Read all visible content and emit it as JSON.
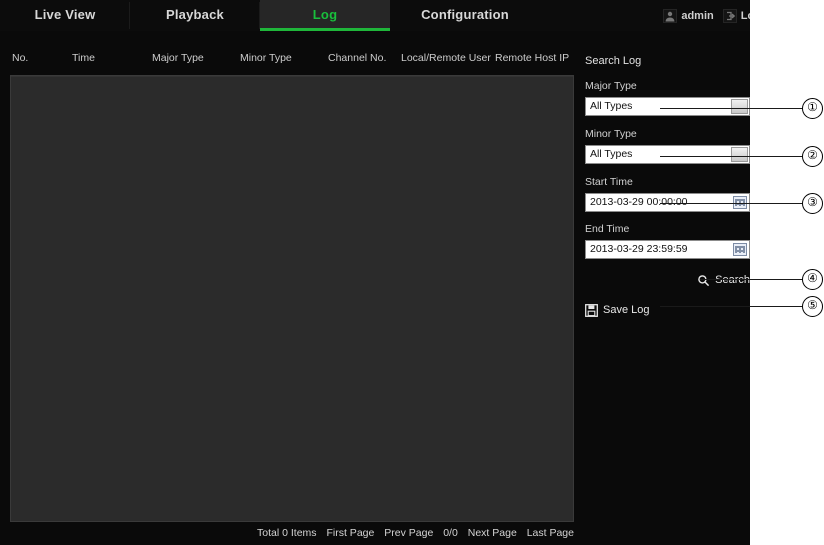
{
  "nav": {
    "tabs": [
      {
        "label": "Live View",
        "active": false
      },
      {
        "label": "Playback",
        "active": false
      },
      {
        "label": "Log",
        "active": true
      },
      {
        "label": "Configuration",
        "active": false
      }
    ]
  },
  "account": {
    "user_icon": "user-icon",
    "user": "admin",
    "logout_icon": "logout-icon",
    "logout": "Logout"
  },
  "table": {
    "columns": [
      "No.",
      "Time",
      "Major Type",
      "Minor Type",
      "Channel No.",
      "Local/Remote User",
      "Remote Host IP"
    ],
    "rows": []
  },
  "pager": {
    "total": "Total 0 Items",
    "first": "First Page",
    "prev": "Prev Page",
    "position": "0/0",
    "next": "Next Page",
    "last": "Last Page"
  },
  "search_panel": {
    "title": "Search Log",
    "major_type": {
      "label": "Major Type",
      "value": "All Types",
      "icon": "chevron-down-icon"
    },
    "minor_type": {
      "label": "Minor Type",
      "value": "All Types",
      "icon": "chevron-down-icon"
    },
    "start_time": {
      "label": "Start Time",
      "value": "2013-03-29 00:00:00",
      "icon": "calendar-icon"
    },
    "end_time": {
      "label": "End Time",
      "value": "2013-03-29 23:59:59",
      "icon": "calendar-icon"
    },
    "search_button": {
      "label": "Search",
      "icon": "search-icon"
    },
    "save_button": {
      "label": "Save Log",
      "icon": "save-disk-icon"
    }
  },
  "callouts": [
    {
      "number": "①"
    },
    {
      "number": "②"
    },
    {
      "number": "③"
    },
    {
      "number": "④"
    },
    {
      "number": "⑤"
    }
  ],
  "colors": {
    "accent_green": "#1fb63a",
    "app_background": "#0a0a0a",
    "panel_background": "#2b2b2b",
    "field_background": "#ffffff"
  }
}
